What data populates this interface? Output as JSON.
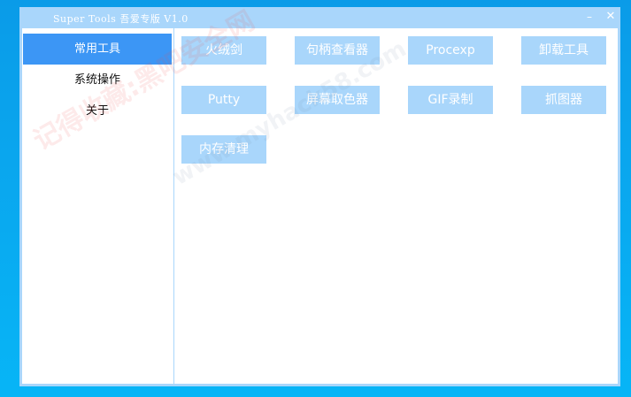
{
  "window": {
    "title": "Super Tools 吾爱专版 V1.0",
    "minimize_glyph": "–",
    "close_glyph": "✕"
  },
  "sidebar": {
    "items": [
      {
        "label": "常用工具",
        "active": true
      },
      {
        "label": "系统操作",
        "active": false
      },
      {
        "label": "关于",
        "active": false
      }
    ]
  },
  "tools": [
    {
      "label": "火绒剑"
    },
    {
      "label": "句柄查看器"
    },
    {
      "label": "Procexp"
    },
    {
      "label": "卸载工具"
    },
    {
      "label": "Putty"
    },
    {
      "label": "屏幕取色器"
    },
    {
      "label": "GIF录制"
    },
    {
      "label": "抓图器"
    },
    {
      "label": "内存清理"
    }
  ],
  "watermark": {
    "line1": "记得收藏:黑吧安全网",
    "line2": "www.myhack58.com"
  },
  "colors": {
    "desktop": "#0aa6ee",
    "window_frame": "#a9d6fb",
    "active_item": "#3c96f5",
    "button": "#a9d6fb"
  }
}
